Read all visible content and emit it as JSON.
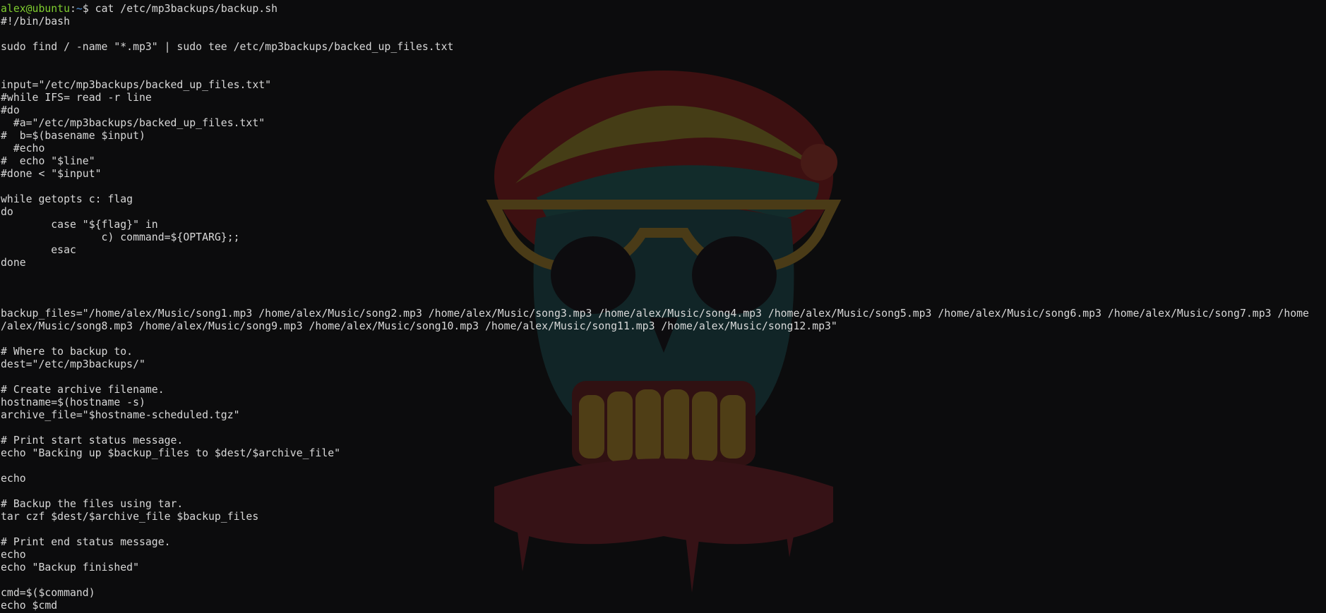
{
  "prompt": {
    "user_host": "alex@ubuntu",
    "sep": ":",
    "path": "~",
    "dollar": "$ ",
    "command": "cat /etc/mp3backups/backup.sh"
  },
  "output_lines": [
    "#!/bin/bash",
    "",
    "sudo find / -name \"*.mp3\" | sudo tee /etc/mp3backups/backed_up_files.txt",
    "",
    "",
    "input=\"/etc/mp3backups/backed_up_files.txt\"",
    "#while IFS= read -r line",
    "#do",
    "  #a=\"/etc/mp3backups/backed_up_files.txt\"",
    "#  b=$(basename $input)",
    "  #echo",
    "#  echo \"$line\"",
    "#done < \"$input\"",
    "",
    "while getopts c: flag",
    "do",
    "        case \"${flag}\" in",
    "                c) command=${OPTARG};;",
    "        esac",
    "done",
    "",
    "",
    "",
    "backup_files=\"/home/alex/Music/song1.mp3 /home/alex/Music/song2.mp3 /home/alex/Music/song3.mp3 /home/alex/Music/song4.mp3 /home/alex/Music/song5.mp3 /home/alex/Music/song6.mp3 /home/alex/Music/song7.mp3 /home",
    "/alex/Music/song8.mp3 /home/alex/Music/song9.mp3 /home/alex/Music/song10.mp3 /home/alex/Music/song11.mp3 /home/alex/Music/song12.mp3\"",
    "",
    "# Where to backup to.",
    "dest=\"/etc/mp3backups/\"",
    "",
    "# Create archive filename.",
    "hostname=$(hostname -s)",
    "archive_file=\"$hostname-scheduled.tgz\"",
    "",
    "# Print start status message.",
    "echo \"Backing up $backup_files to $dest/$archive_file\"",
    "",
    "echo",
    "",
    "# Backup the files using tar.",
    "tar czf $dest/$archive_file $backup_files",
    "",
    "# Print end status message.",
    "echo",
    "echo \"Backup finished\"",
    "",
    "cmd=$($command)",
    "echo $cmd"
  ],
  "colors": {
    "prompt_user": "#7fce2f",
    "prompt_path": "#4d8fd6",
    "text": "#d8d8d8",
    "background": "#0c0c0d"
  },
  "wallpaper_icon": "skull-wallpaper-icon"
}
